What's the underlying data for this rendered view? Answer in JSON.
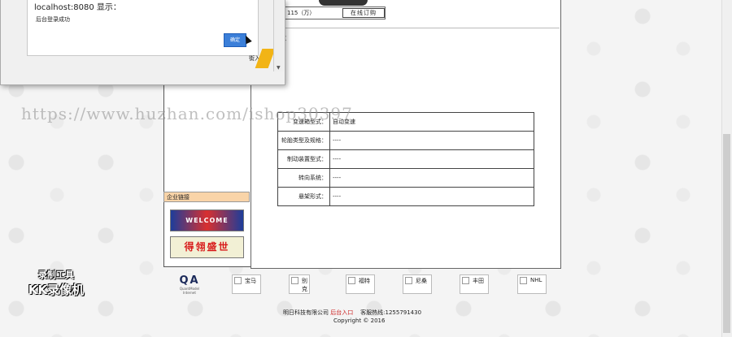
{
  "dialog": {
    "title": "localhost:8080 显示：",
    "message": "后台登录成功",
    "ok_label": "确定",
    "side_label": "街入"
  },
  "product": {
    "price_text": "格：115（万）",
    "order_button": "在线订购"
  },
  "section_title": "数",
  "spec_table": {
    "rows": [
      {
        "label": "变速箱型式：",
        "value": "自动变速"
      },
      {
        "label": "轮胎类型及规格：",
        "value": "----"
      },
      {
        "label": "制动装置型式：",
        "value": "----"
      },
      {
        "label": "转向系统：",
        "value": "----"
      },
      {
        "label": "悬架形式：",
        "value": "----"
      }
    ]
  },
  "sidebar": {
    "links_header": "企业链接",
    "banner1_text": "WELCOME",
    "banner2_text": "得翎盛世"
  },
  "brands": {
    "qa_logo": "QA",
    "qa_sub": "QuantModel Internet",
    "items": [
      "宝马",
      "别克",
      "福特",
      "尼桑",
      "丰田",
      "NHL"
    ]
  },
  "footer": {
    "company": "明日科技有限公司",
    "admin_link": "后台入口",
    "hotline": "客服热线:1255791430",
    "copyright": "Copyright © 2016"
  },
  "overlay": {
    "watermark": "https://www.huzhan.com/ishop30397",
    "recorder_line1": "录制工具",
    "recorder_line2": "KK录像机"
  }
}
